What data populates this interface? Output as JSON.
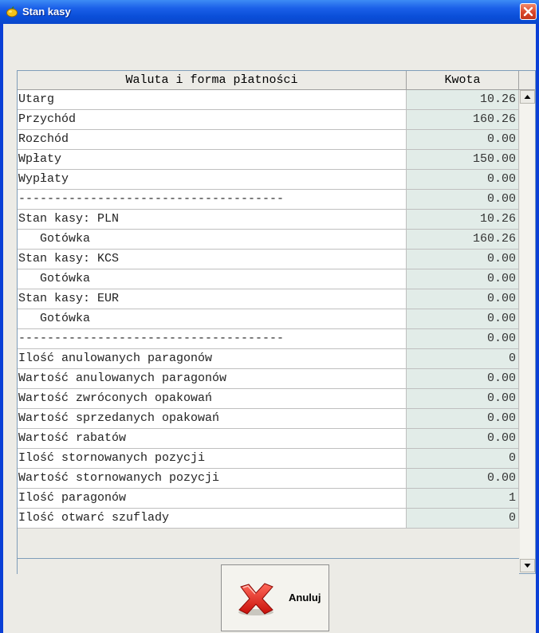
{
  "window": {
    "title": "Stan kasy",
    "close_icon": "close-icon",
    "app_icon": "lemon-icon"
  },
  "table": {
    "columns": [
      "Waluta i forma płatności",
      "Kwota"
    ],
    "rows": [
      {
        "label": "Utarg",
        "value": "10.26"
      },
      {
        "label": "Przychód",
        "value": "160.26"
      },
      {
        "label": "Rozchód",
        "value": "0.00"
      },
      {
        "label": "Wpłaty",
        "value": "150.00"
      },
      {
        "label": "Wypłaty",
        "value": "0.00"
      },
      {
        "label": "-------------------------------------",
        "value": "0.00"
      },
      {
        "label": "Stan kasy: PLN",
        "value": "10.26"
      },
      {
        "label": "   Gotówka",
        "value": "160.26"
      },
      {
        "label": "Stan kasy: KCS",
        "value": "0.00"
      },
      {
        "label": "   Gotówka",
        "value": "0.00"
      },
      {
        "label": "Stan kasy: EUR",
        "value": "0.00"
      },
      {
        "label": "   Gotówka",
        "value": "0.00"
      },
      {
        "label": "-------------------------------------",
        "value": "0.00"
      },
      {
        "label": "Ilość anulowanych paragonów",
        "value": "0"
      },
      {
        "label": "Wartość anulowanych paragonów",
        "value": "0.00"
      },
      {
        "label": "Wartość zwróconych opakowań",
        "value": "0.00"
      },
      {
        "label": "Wartość sprzedanych opakowań",
        "value": "0.00"
      },
      {
        "label": "Wartość rabatów",
        "value": "0.00"
      },
      {
        "label": "Ilość stornowanych pozycji",
        "value": "0"
      },
      {
        "label": "Wartość stornowanych pozycji",
        "value": "0.00"
      },
      {
        "label": "Ilość paragonów",
        "value": "1"
      },
      {
        "label": "Ilość otwarć szuflady",
        "value": "0"
      }
    ]
  },
  "buttons": {
    "cancel_label": "Anuluj",
    "cancel_icon": "red-x-icon"
  },
  "colors": {
    "titlebar": "#0a4ed8",
    "value_cell_bg": "#e2ece8",
    "close_button": "#d9452a"
  }
}
